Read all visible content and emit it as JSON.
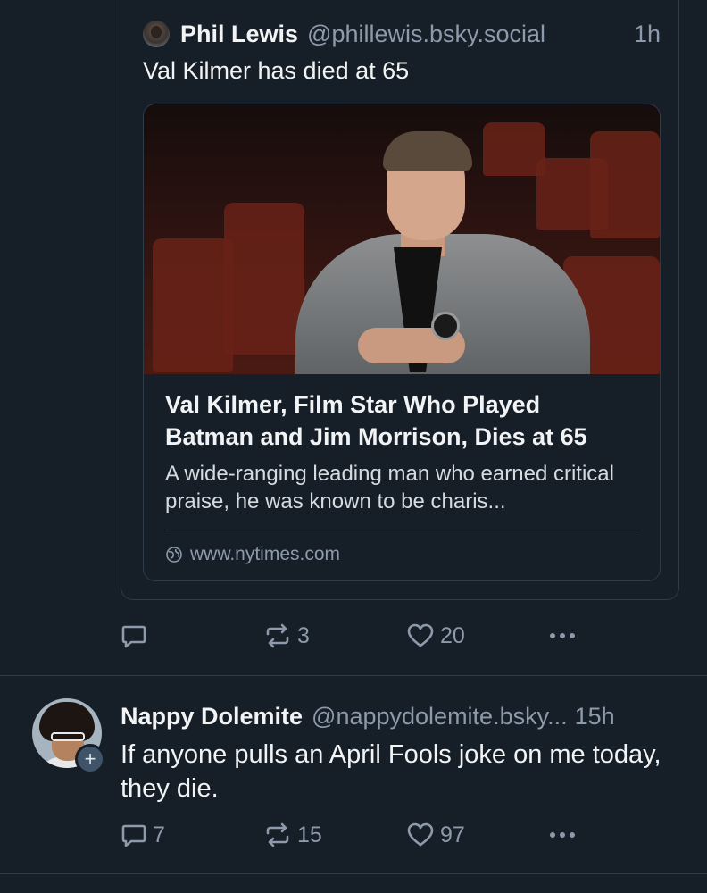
{
  "quoted_post": {
    "author_name": "Phil Lewis",
    "author_handle": "@phillewis.bsky.social",
    "time": "1h",
    "text": "Val Kilmer has died at 65",
    "embed": {
      "title": "Val Kilmer, Film Star Who Played Batman and Jim Morrison, Dies at 65",
      "description": "A wide-ranging leading man who earned critical praise, he was known to be charis...",
      "domain": "www.nytimes.com"
    }
  },
  "first_post_actions": {
    "replies": "",
    "reposts": "3",
    "likes": "20"
  },
  "second_post": {
    "author_name": "Nappy Dolemite",
    "author_handle": "@nappydolemite.bsky...",
    "time": "15h",
    "text": "If anyone pulls an April Fools joke on me today, they die.",
    "follow_badge": "+",
    "actions": {
      "replies": "7",
      "reposts": "15",
      "likes": "97"
    }
  },
  "colors": {
    "background": "#161e27",
    "border": "#2e3b49",
    "muted": "#8c9aab",
    "text": "#f1f3f5"
  },
  "icons": [
    "reply-icon",
    "repost-icon",
    "like-icon",
    "more-icon",
    "globe-icon",
    "follow-plus-icon"
  ]
}
